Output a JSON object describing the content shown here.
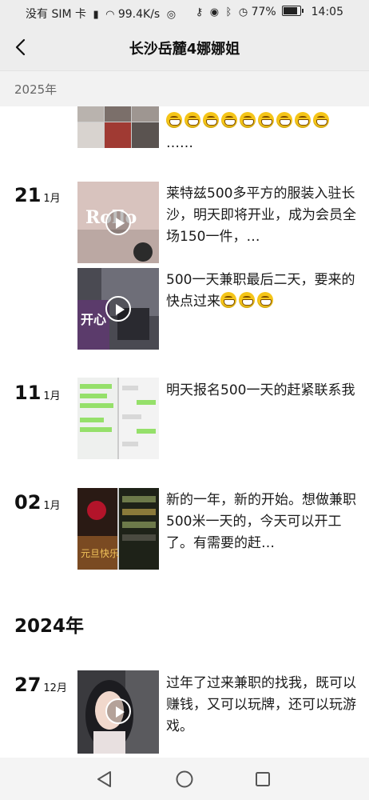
{
  "status_bar": {
    "carrier": "没有 SIM 卡",
    "speed": "99.4K/s",
    "battery_pct": "77%",
    "time": "14:05"
  },
  "header": {
    "title": "长沙岳麓4娜娜姐"
  },
  "sticky_year": "2025年",
  "posts": [
    {
      "day": "",
      "month": "",
      "text": "……"
    },
    {
      "day": "21",
      "month": "1月",
      "text": "莱特兹500多平方的服装入驻长沙，明天即将开业，成为会员全场150一件，…"
    },
    {
      "day": "",
      "month": "",
      "text": "500一天兼职最后二天，要来的快点过来"
    },
    {
      "day": "11",
      "month": "1月",
      "text": "明天报名500一天的赶紧联系我"
    },
    {
      "day": "02",
      "month": "1月",
      "text": "新的一年，新的开始。想做兼职500米一天的，今天可以开工了。有需要的赶…"
    },
    {
      "day": "27",
      "month": "12月",
      "text": "过年了过来兼职的找我，既可以赚钱，又可以玩牌，还可以玩游戏。"
    }
  ],
  "year_2024": "2024年",
  "colors": {
    "status_bg": "#ededed",
    "page_bg": "#ffffff",
    "sticky_bg": "#f2f2f2",
    "emoji": "#f5c518"
  },
  "icons": [
    "back-icon",
    "play-icon",
    "grin-emoji-icon",
    "nav-back-icon",
    "nav-home-icon",
    "nav-recents-icon"
  ]
}
